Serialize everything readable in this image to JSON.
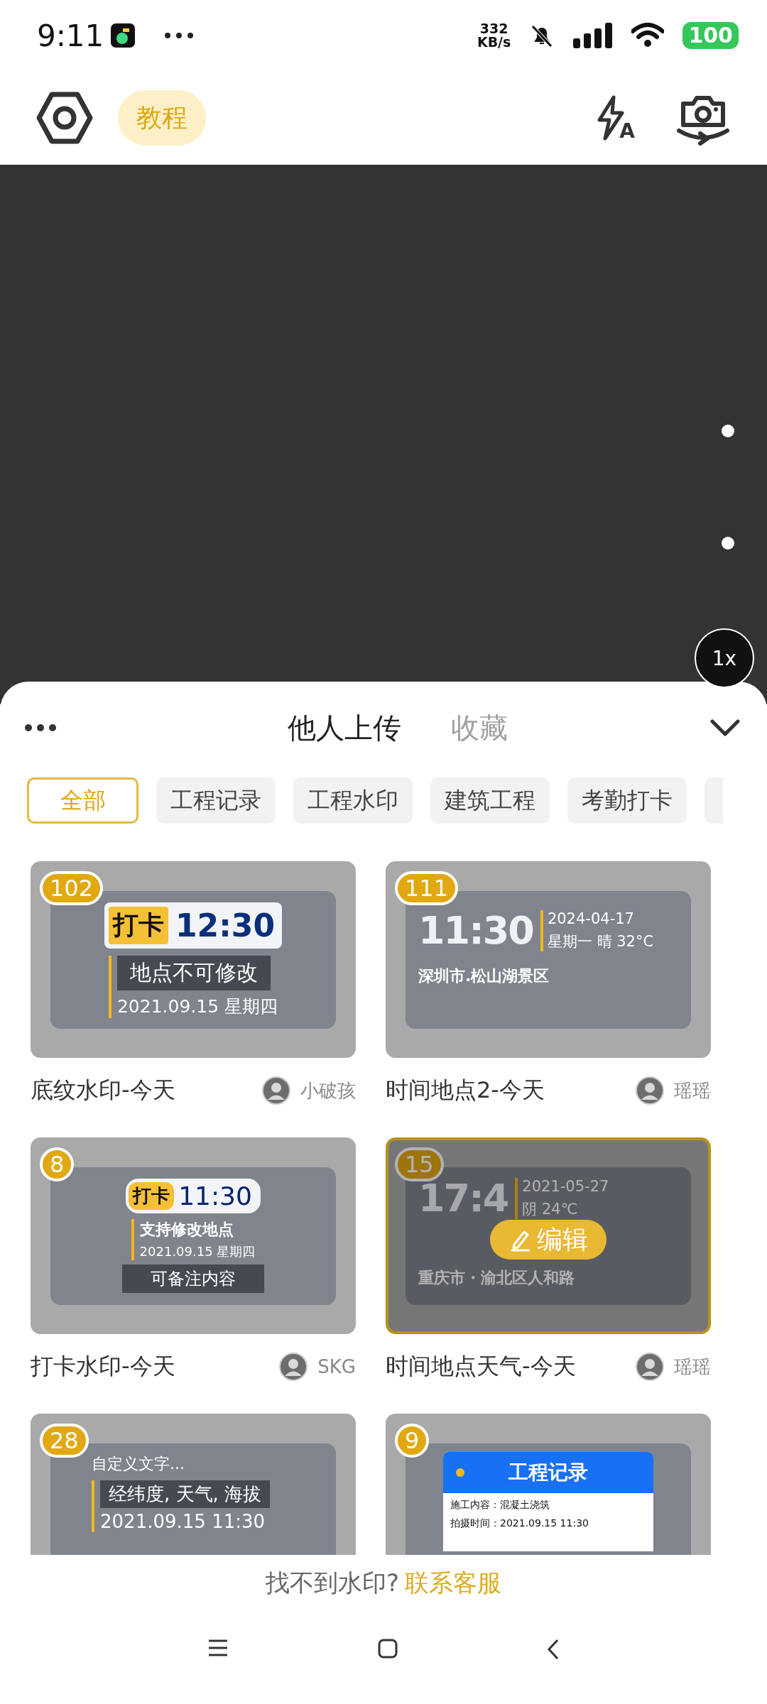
{
  "status_bar": {
    "time": "9:11",
    "net_speed_value": "332",
    "net_speed_unit": "KB/s",
    "battery": "100"
  },
  "toolbar": {
    "tutorial_button": "教程",
    "flash_mode": "A"
  },
  "camera": {
    "zoom": "1x"
  },
  "sheet": {
    "tabs": [
      {
        "label": "他人上传",
        "selected": true
      },
      {
        "label": "收藏",
        "selected": false
      }
    ],
    "filters": [
      {
        "label": "全部",
        "selected": true
      },
      {
        "label": "工程记录",
        "selected": false
      },
      {
        "label": "工程水印",
        "selected": false
      },
      {
        "label": "建筑工程",
        "selected": false
      },
      {
        "label": "考勤打卡",
        "selected": false
      }
    ],
    "edit_button": "编辑",
    "cards": [
      {
        "kind": "punch",
        "count": "102",
        "selected": false,
        "title": "底纹水印-今天",
        "author": "小破孩",
        "tag": "打卡",
        "time": "12:30",
        "location": "地点不可修改",
        "date": "2021.09.15  星期四"
      },
      {
        "kind": "time-location",
        "count": "111",
        "selected": false,
        "title": "时间地点2-今天",
        "author": "瑶瑶",
        "time": "11:30",
        "date": "2024-04-17",
        "weather": "星期一 晴 32°C",
        "place": "深圳市.松山湖景区"
      },
      {
        "kind": "punch-note",
        "count": "8",
        "selected": false,
        "title": "打卡水印-今天",
        "author": "SKG",
        "tag": "打卡",
        "time": "11:30",
        "location": "支持修改地点",
        "date": "2021.09.15 星期四",
        "note": "可备注内容"
      },
      {
        "kind": "time-location",
        "count": "15",
        "selected": true,
        "title": "时间地点天气-今天",
        "author": "瑶瑶",
        "time": "17:4",
        "date": "2021-05-27",
        "weather": "阴 24℃",
        "place": "重庆市・渝北区人和路"
      },
      {
        "kind": "custom",
        "count": "28",
        "selected": false,
        "header": "自定义文字...",
        "info": "经纬度, 天气, 海拔",
        "date": "2021.09.15 11:30"
      },
      {
        "kind": "project",
        "count": "9",
        "selected": false,
        "header": "工程记录",
        "rows": [
          "施工内容：混凝土浇筑",
          "拍摄时间：2021.09.15 11:30"
        ]
      }
    ]
  },
  "footer": {
    "prompt": "找不到水印?",
    "link": "联系客服"
  }
}
